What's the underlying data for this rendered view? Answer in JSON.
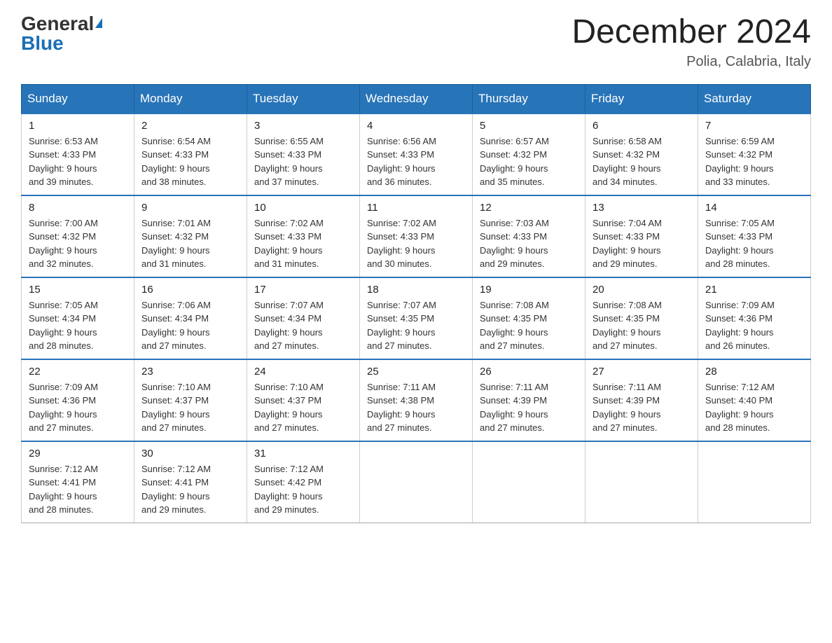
{
  "header": {
    "logo_general": "General",
    "logo_blue": "Blue",
    "month_title": "December 2024",
    "location": "Polia, Calabria, Italy"
  },
  "days_of_week": [
    "Sunday",
    "Monday",
    "Tuesday",
    "Wednesday",
    "Thursday",
    "Friday",
    "Saturday"
  ],
  "weeks": [
    [
      {
        "day": "1",
        "sunrise": "6:53 AM",
        "sunset": "4:33 PM",
        "daylight": "9 hours and 39 minutes."
      },
      {
        "day": "2",
        "sunrise": "6:54 AM",
        "sunset": "4:33 PM",
        "daylight": "9 hours and 38 minutes."
      },
      {
        "day": "3",
        "sunrise": "6:55 AM",
        "sunset": "4:33 PM",
        "daylight": "9 hours and 37 minutes."
      },
      {
        "day": "4",
        "sunrise": "6:56 AM",
        "sunset": "4:33 PM",
        "daylight": "9 hours and 36 minutes."
      },
      {
        "day": "5",
        "sunrise": "6:57 AM",
        "sunset": "4:32 PM",
        "daylight": "9 hours and 35 minutes."
      },
      {
        "day": "6",
        "sunrise": "6:58 AM",
        "sunset": "4:32 PM",
        "daylight": "9 hours and 34 minutes."
      },
      {
        "day": "7",
        "sunrise": "6:59 AM",
        "sunset": "4:32 PM",
        "daylight": "9 hours and 33 minutes."
      }
    ],
    [
      {
        "day": "8",
        "sunrise": "7:00 AM",
        "sunset": "4:32 PM",
        "daylight": "9 hours and 32 minutes."
      },
      {
        "day": "9",
        "sunrise": "7:01 AM",
        "sunset": "4:32 PM",
        "daylight": "9 hours and 31 minutes."
      },
      {
        "day": "10",
        "sunrise": "7:02 AM",
        "sunset": "4:33 PM",
        "daylight": "9 hours and 31 minutes."
      },
      {
        "day": "11",
        "sunrise": "7:02 AM",
        "sunset": "4:33 PM",
        "daylight": "9 hours and 30 minutes."
      },
      {
        "day": "12",
        "sunrise": "7:03 AM",
        "sunset": "4:33 PM",
        "daylight": "9 hours and 29 minutes."
      },
      {
        "day": "13",
        "sunrise": "7:04 AM",
        "sunset": "4:33 PM",
        "daylight": "9 hours and 29 minutes."
      },
      {
        "day": "14",
        "sunrise": "7:05 AM",
        "sunset": "4:33 PM",
        "daylight": "9 hours and 28 minutes."
      }
    ],
    [
      {
        "day": "15",
        "sunrise": "7:05 AM",
        "sunset": "4:34 PM",
        "daylight": "9 hours and 28 minutes."
      },
      {
        "day": "16",
        "sunrise": "7:06 AM",
        "sunset": "4:34 PM",
        "daylight": "9 hours and 27 minutes."
      },
      {
        "day": "17",
        "sunrise": "7:07 AM",
        "sunset": "4:34 PM",
        "daylight": "9 hours and 27 minutes."
      },
      {
        "day": "18",
        "sunrise": "7:07 AM",
        "sunset": "4:35 PM",
        "daylight": "9 hours and 27 minutes."
      },
      {
        "day": "19",
        "sunrise": "7:08 AM",
        "sunset": "4:35 PM",
        "daylight": "9 hours and 27 minutes."
      },
      {
        "day": "20",
        "sunrise": "7:08 AM",
        "sunset": "4:35 PM",
        "daylight": "9 hours and 27 minutes."
      },
      {
        "day": "21",
        "sunrise": "7:09 AM",
        "sunset": "4:36 PM",
        "daylight": "9 hours and 26 minutes."
      }
    ],
    [
      {
        "day": "22",
        "sunrise": "7:09 AM",
        "sunset": "4:36 PM",
        "daylight": "9 hours and 27 minutes."
      },
      {
        "day": "23",
        "sunrise": "7:10 AM",
        "sunset": "4:37 PM",
        "daylight": "9 hours and 27 minutes."
      },
      {
        "day": "24",
        "sunrise": "7:10 AM",
        "sunset": "4:37 PM",
        "daylight": "9 hours and 27 minutes."
      },
      {
        "day": "25",
        "sunrise": "7:11 AM",
        "sunset": "4:38 PM",
        "daylight": "9 hours and 27 minutes."
      },
      {
        "day": "26",
        "sunrise": "7:11 AM",
        "sunset": "4:39 PM",
        "daylight": "9 hours and 27 minutes."
      },
      {
        "day": "27",
        "sunrise": "7:11 AM",
        "sunset": "4:39 PM",
        "daylight": "9 hours and 27 minutes."
      },
      {
        "day": "28",
        "sunrise": "7:12 AM",
        "sunset": "4:40 PM",
        "daylight": "9 hours and 28 minutes."
      }
    ],
    [
      {
        "day": "29",
        "sunrise": "7:12 AM",
        "sunset": "4:41 PM",
        "daylight": "9 hours and 28 minutes."
      },
      {
        "day": "30",
        "sunrise": "7:12 AM",
        "sunset": "4:41 PM",
        "daylight": "9 hours and 29 minutes."
      },
      {
        "day": "31",
        "sunrise": "7:12 AM",
        "sunset": "4:42 PM",
        "daylight": "9 hours and 29 minutes."
      },
      null,
      null,
      null,
      null
    ]
  ],
  "labels": {
    "sunrise": "Sunrise:",
    "sunset": "Sunset:",
    "daylight": "Daylight:"
  }
}
